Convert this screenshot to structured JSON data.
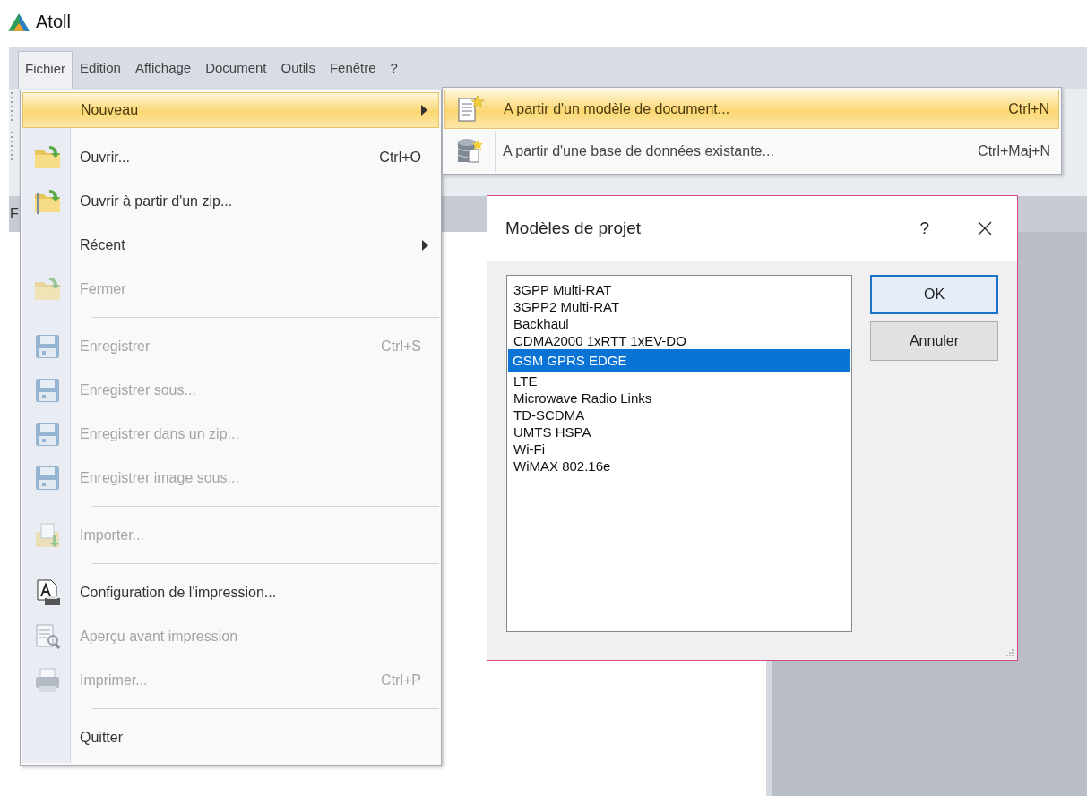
{
  "app": {
    "title": "Atoll"
  },
  "menu_bar": [
    {
      "label": "Fichier",
      "selected": true
    },
    {
      "label": "Edition",
      "selected": false
    },
    {
      "label": "Affichage",
      "selected": false
    },
    {
      "label": "Document",
      "selected": false
    },
    {
      "label": "Outils",
      "selected": false
    },
    {
      "label": "Fenêtre",
      "selected": false
    },
    {
      "label": "?",
      "selected": false
    }
  ],
  "document_tab": {
    "label": "F"
  },
  "file_menu": {
    "items": [
      {
        "kind": "item",
        "label": "Nouveau",
        "highlighted": true,
        "disabled": false,
        "submenu": true
      },
      {
        "kind": "item",
        "label": "Ouvrir...",
        "shortcut": "Ctrl+O",
        "highlighted": false,
        "disabled": false,
        "submenu": false
      },
      {
        "kind": "item",
        "label": "Ouvrir à partir d'un zip...",
        "highlighted": false,
        "disabled": false,
        "submenu": false
      },
      {
        "kind": "item",
        "label": "Récent",
        "highlighted": false,
        "disabled": false,
        "submenu": true
      },
      {
        "kind": "item",
        "label": "Fermer",
        "highlighted": false,
        "disabled": true,
        "submenu": false
      },
      {
        "kind": "separator"
      },
      {
        "kind": "item",
        "label": "Enregistrer",
        "shortcut": "Ctrl+S",
        "highlighted": false,
        "disabled": true,
        "submenu": false
      },
      {
        "kind": "item",
        "label": "Enregistrer sous...",
        "highlighted": false,
        "disabled": true,
        "submenu": false
      },
      {
        "kind": "item",
        "label": "Enregistrer dans un zip...",
        "highlighted": false,
        "disabled": true,
        "submenu": false
      },
      {
        "kind": "item",
        "label": "Enregistrer image sous...",
        "highlighted": false,
        "disabled": true,
        "submenu": false
      },
      {
        "kind": "separator"
      },
      {
        "kind": "item",
        "label": "Importer...",
        "highlighted": false,
        "disabled": true,
        "submenu": false
      },
      {
        "kind": "separator"
      },
      {
        "kind": "item",
        "label": "Configuration de l'impression...",
        "highlighted": false,
        "disabled": false,
        "submenu": false
      },
      {
        "kind": "item",
        "label": "Aperçu avant impression",
        "highlighted": false,
        "disabled": true,
        "submenu": false
      },
      {
        "kind": "item",
        "label": "Imprimer...",
        "shortcut": "Ctrl+P",
        "highlighted": false,
        "disabled": true,
        "submenu": false
      },
      {
        "kind": "separator"
      },
      {
        "kind": "item",
        "label": "Quitter",
        "highlighted": false,
        "disabled": false,
        "submenu": false
      }
    ]
  },
  "submenu": {
    "items": [
      {
        "label": "A partir d'un modèle de document...",
        "shortcut": "Ctrl+N",
        "highlighted": true
      },
      {
        "label": "A partir d'une base de données existante...",
        "shortcut": "Ctrl+Maj+N",
        "highlighted": false
      }
    ]
  },
  "dialog": {
    "title": "Modèles de projet",
    "help": "?",
    "list": [
      {
        "label": "3GPP Multi-RAT",
        "selected": false
      },
      {
        "label": "3GPP2 Multi-RAT",
        "selected": false
      },
      {
        "label": "Backhaul",
        "selected": false
      },
      {
        "label": "CDMA2000 1xRTT 1xEV-DO",
        "selected": false
      },
      {
        "label": "GSM GPRS EDGE",
        "selected": true
      },
      {
        "label": "LTE",
        "selected": false
      },
      {
        "label": "Microwave Radio Links",
        "selected": false
      },
      {
        "label": "TD-SCDMA",
        "selected": false
      },
      {
        "label": "UMTS HSPA",
        "selected": false
      },
      {
        "label": "Wi-Fi",
        "selected": false
      },
      {
        "label": "WiMAX 802.16e",
        "selected": false
      }
    ],
    "buttons": [
      {
        "label": "OK",
        "default": true
      },
      {
        "label": "Annuler",
        "default": false
      }
    ]
  }
}
